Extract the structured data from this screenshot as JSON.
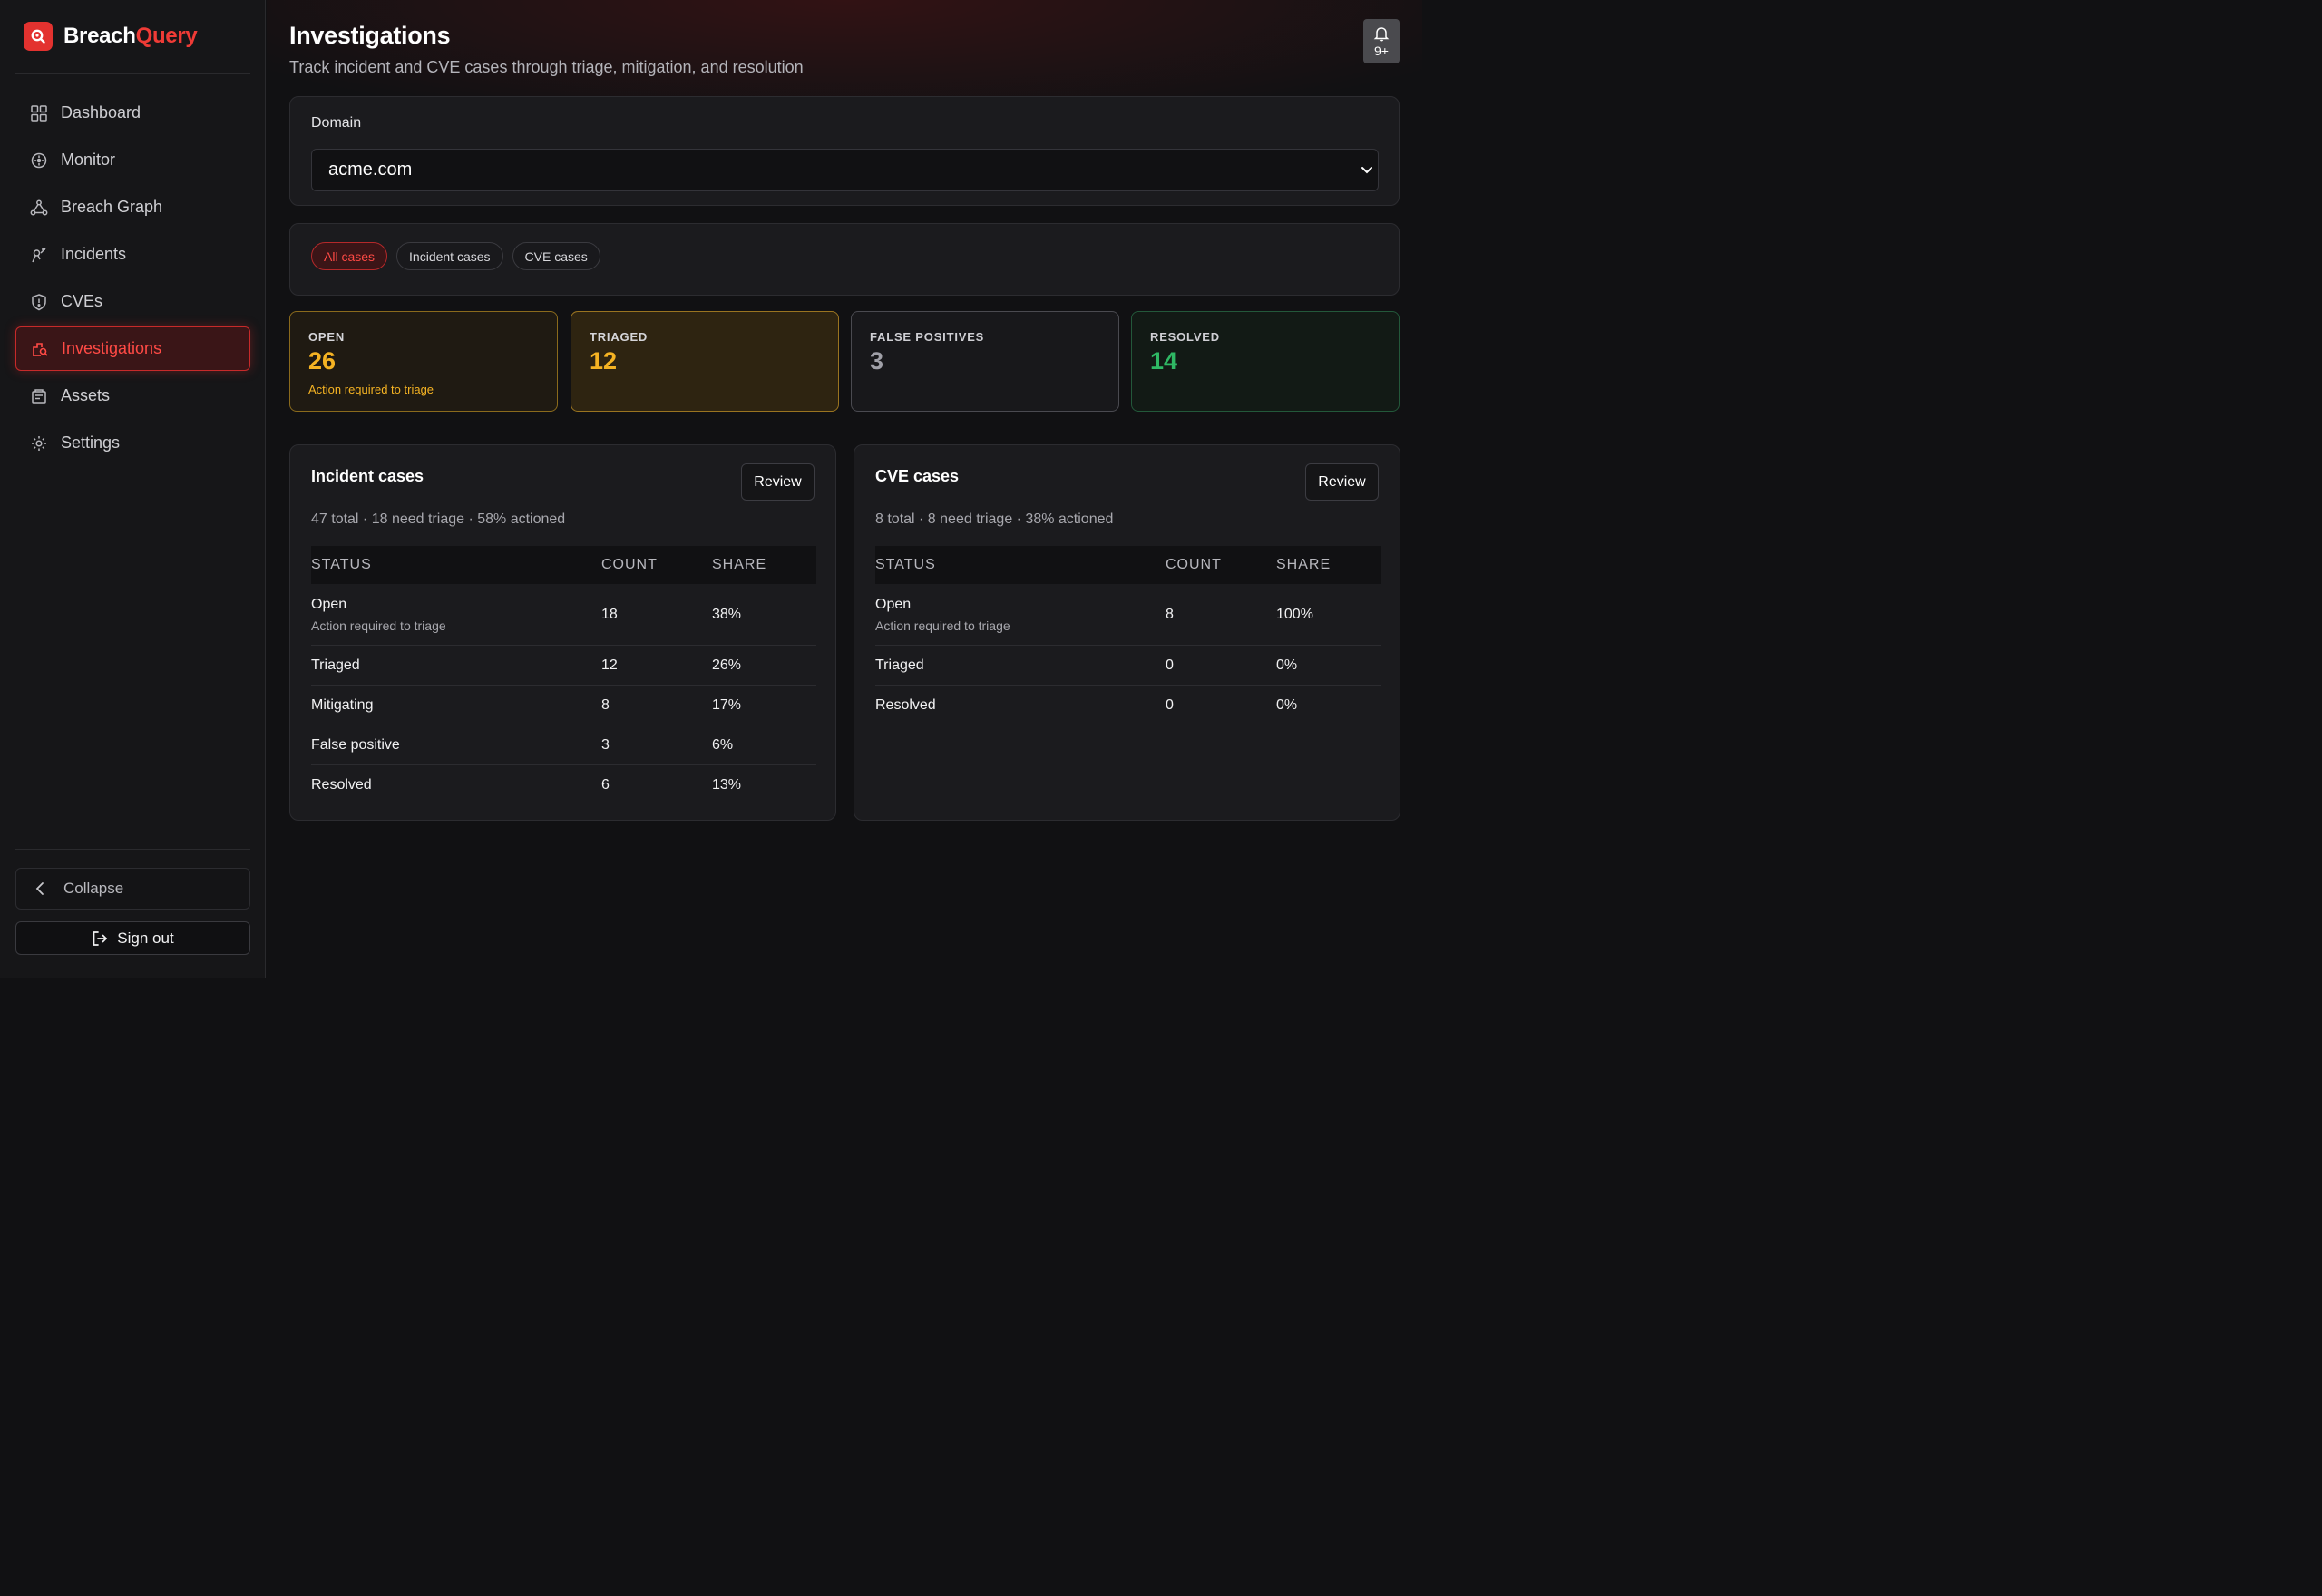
{
  "brand": {
    "name": "Breach",
    "accent": "Query"
  },
  "sidebar": {
    "items": [
      {
        "label": "Dashboard"
      },
      {
        "label": "Monitor"
      },
      {
        "label": "Breach Graph"
      },
      {
        "label": "Incidents"
      },
      {
        "label": "CVEs"
      },
      {
        "label": "Investigations"
      },
      {
        "label": "Assets"
      },
      {
        "label": "Settings"
      }
    ],
    "active": "Investigations",
    "collapse_label": "Collapse",
    "signout_label": "Sign out"
  },
  "header": {
    "title": "Investigations",
    "subtitle": "Track incident and CVE cases through triage, mitigation, and resolution",
    "notification_count": "9+"
  },
  "domain": {
    "label": "Domain",
    "selected": "acme.com"
  },
  "filters": {
    "chips": [
      "All cases",
      "Incident cases",
      "CVE cases"
    ],
    "active": "All cases"
  },
  "stats": {
    "open": {
      "label": "OPEN",
      "value": "26",
      "note": "Action required to triage"
    },
    "triaged": {
      "label": "TRIAGED",
      "value": "12"
    },
    "false_positives": {
      "label": "FALSE POSITIVES",
      "value": "3"
    },
    "resolved": {
      "label": "RESOLVED",
      "value": "14"
    }
  },
  "incident_panel": {
    "title": "Incident cases",
    "review_label": "Review",
    "summary": "47 total · 18 need triage · 58% actioned",
    "columns": [
      "STATUS",
      "COUNT",
      "SHARE"
    ],
    "rows": [
      {
        "status": "Open",
        "sub": "Action required to triage",
        "count": "18",
        "share": "38%"
      },
      {
        "status": "Triaged",
        "count": "12",
        "share": "26%"
      },
      {
        "status": "Mitigating",
        "count": "8",
        "share": "17%"
      },
      {
        "status": "False positive",
        "count": "3",
        "share": "6%"
      },
      {
        "status": "Resolved",
        "count": "6",
        "share": "13%"
      }
    ]
  },
  "cve_panel": {
    "title": "CVE cases",
    "review_label": "Review",
    "summary": "8 total · 8 need triage · 38% actioned",
    "columns": [
      "STATUS",
      "COUNT",
      "SHARE"
    ],
    "rows": [
      {
        "status": "Open",
        "sub": "Action required to triage",
        "count": "8",
        "share": "100%"
      },
      {
        "status": "Triaged",
        "count": "0",
        "share": "0%"
      },
      {
        "status": "Resolved",
        "count": "0",
        "share": "0%"
      }
    ]
  },
  "colors": {
    "accent": "#ef3b36",
    "warning": "#f5b323",
    "success": "#2fb864",
    "background": "#111113"
  },
  "icons": {
    "dashboard": "grid-icon",
    "monitor": "crosshair-icon",
    "breach_graph": "graph-icon",
    "incidents": "incident-icon",
    "cves": "shield-icon",
    "investigations": "investigation-icon",
    "assets": "assets-icon",
    "settings": "gear-icon",
    "notifications": "bell-icon"
  }
}
